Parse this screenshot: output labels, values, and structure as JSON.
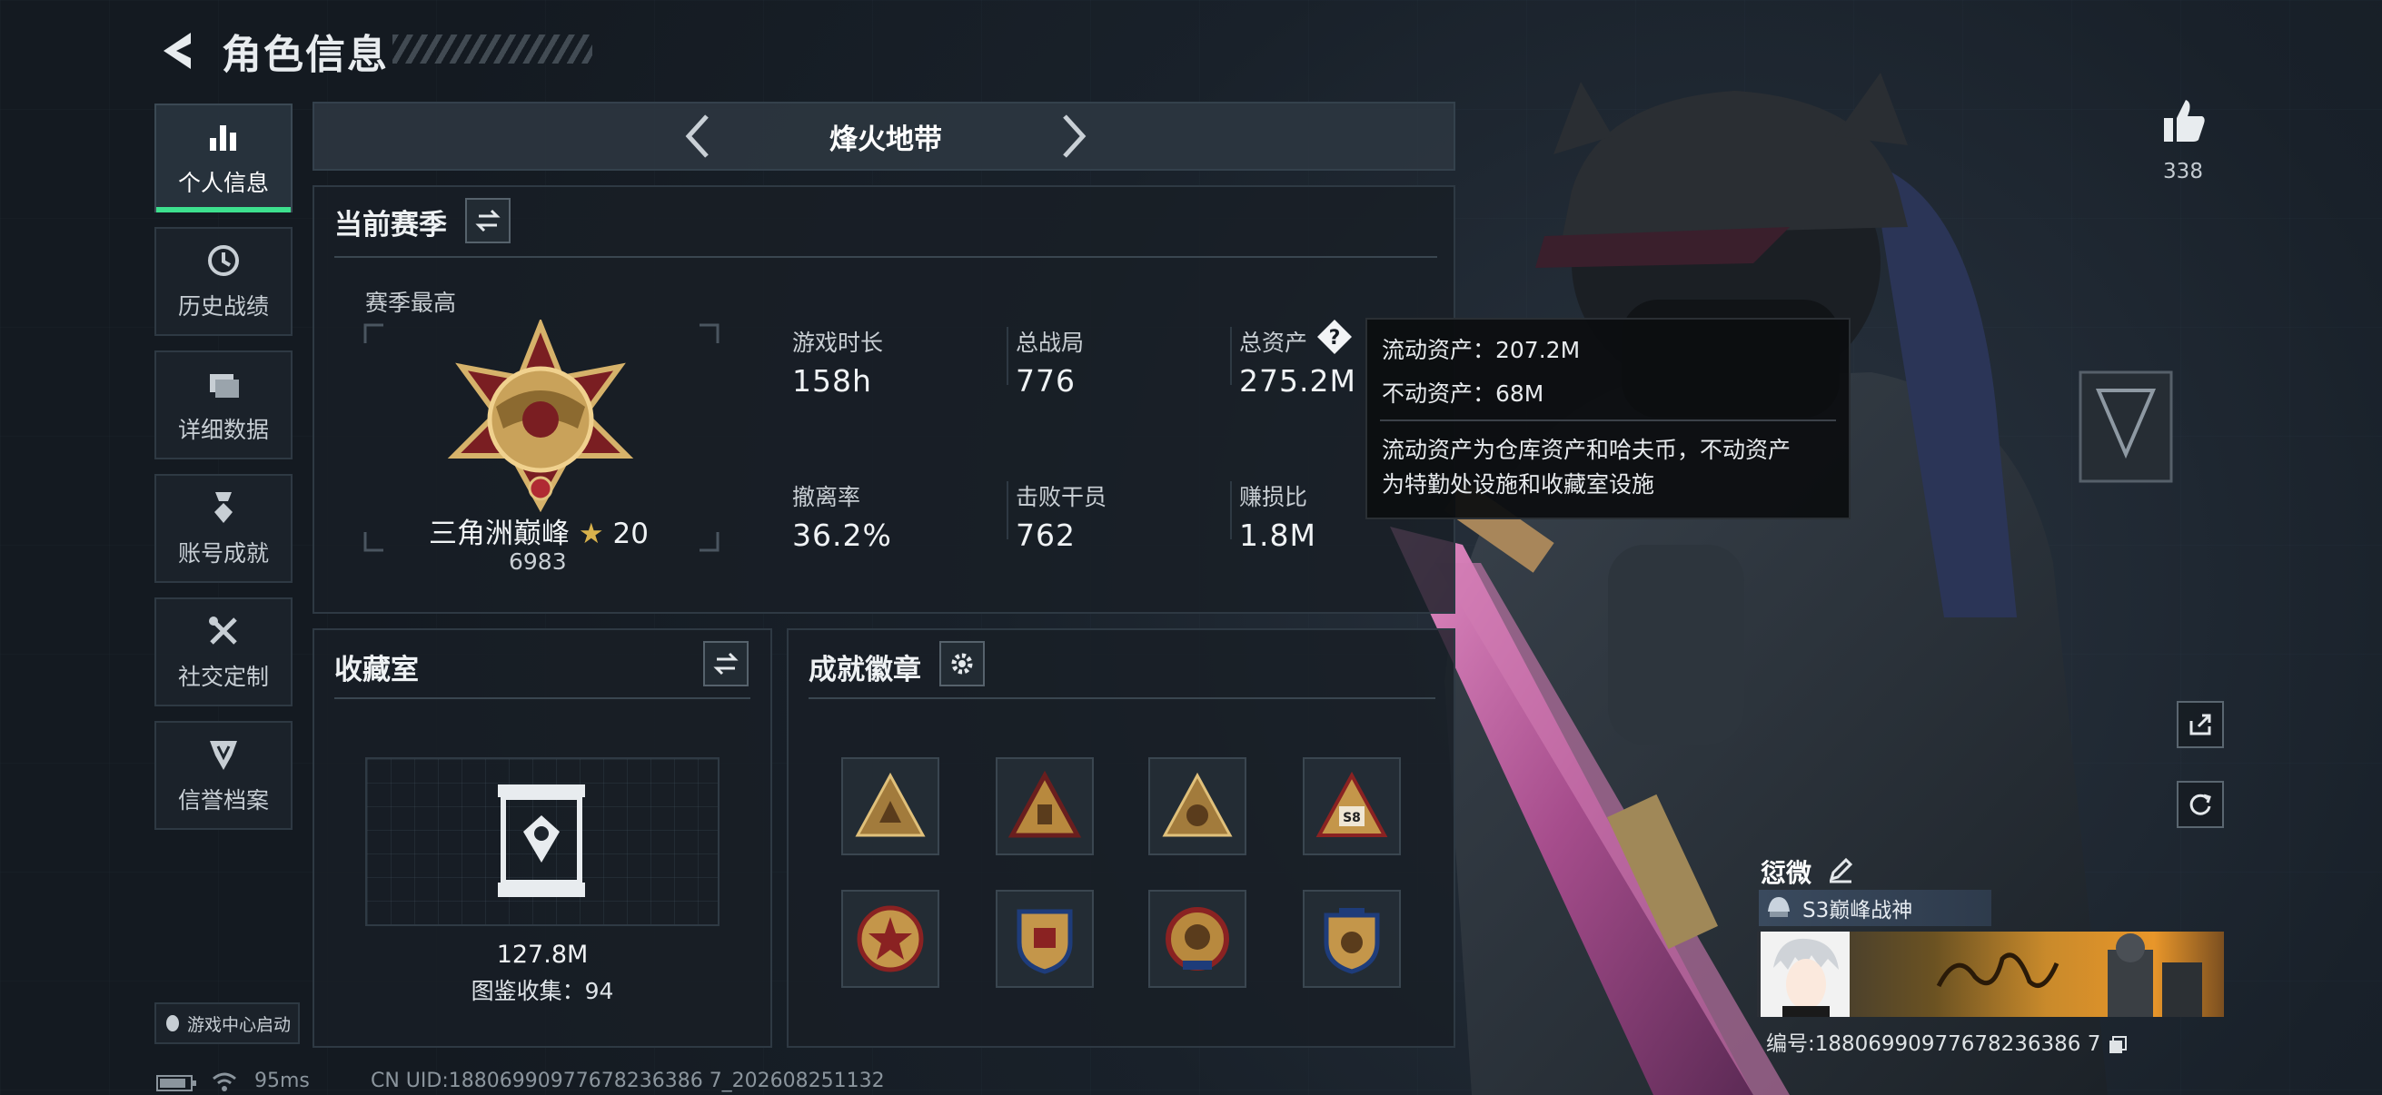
{
  "header": {
    "title": "角色信息"
  },
  "sidebar": {
    "items": [
      {
        "label": "个人信息",
        "icon": "bar-chart-icon",
        "active": true
      },
      {
        "label": "历史战绩",
        "icon": "history-clock-icon"
      },
      {
        "label": "详细数据",
        "icon": "folder-stack-icon"
      },
      {
        "label": "账号成就",
        "icon": "achievement-medal-icon"
      },
      {
        "label": "社交定制",
        "icon": "tools-icon"
      },
      {
        "label": "信誉档案",
        "icon": "credit-shield-icon"
      }
    ],
    "launch_label": "游戏中心启动"
  },
  "mode": {
    "title": "烽火地带"
  },
  "season": {
    "title": "当前赛季",
    "peak_label": "赛季最高",
    "rank_name": "三角洲巅峰",
    "rank_stars": "20",
    "rank_score": "6983",
    "stats": [
      {
        "label": "游戏时长",
        "value": "158h"
      },
      {
        "label": "总战局",
        "value": "776"
      },
      {
        "label": "总资产",
        "value": "275.2M"
      },
      {
        "label": "撤离率",
        "value": "36.2%"
      },
      {
        "label": "击败干员",
        "value": "762"
      },
      {
        "label": "赚损比",
        "value": "1.8M"
      }
    ]
  },
  "tooltip": {
    "liquid": "流动资产：207.2M",
    "fixed": "不动资产：68M",
    "desc_1": "流动资产为仓库资产和哈夫币，不动资产",
    "desc_2": "为特勤处设施和收藏室设施"
  },
  "collection": {
    "title": "收藏室",
    "value": "127.8M",
    "catalog": "图鉴收集：94"
  },
  "badges": {
    "title": "成就徽章",
    "s8_label": "S8"
  },
  "social": {
    "likes": "338"
  },
  "player": {
    "name": "愆微",
    "title_badge": "S3巅峰战神",
    "uid_line": "编号:18806990977678236386 7"
  },
  "status": {
    "ping": "95ms",
    "uid": "CN UID:18806990977678236386 7_202608251132"
  },
  "colors": {
    "accent_green": "#3de08e",
    "gold": "#c9a25a",
    "bg": "#141a21"
  }
}
